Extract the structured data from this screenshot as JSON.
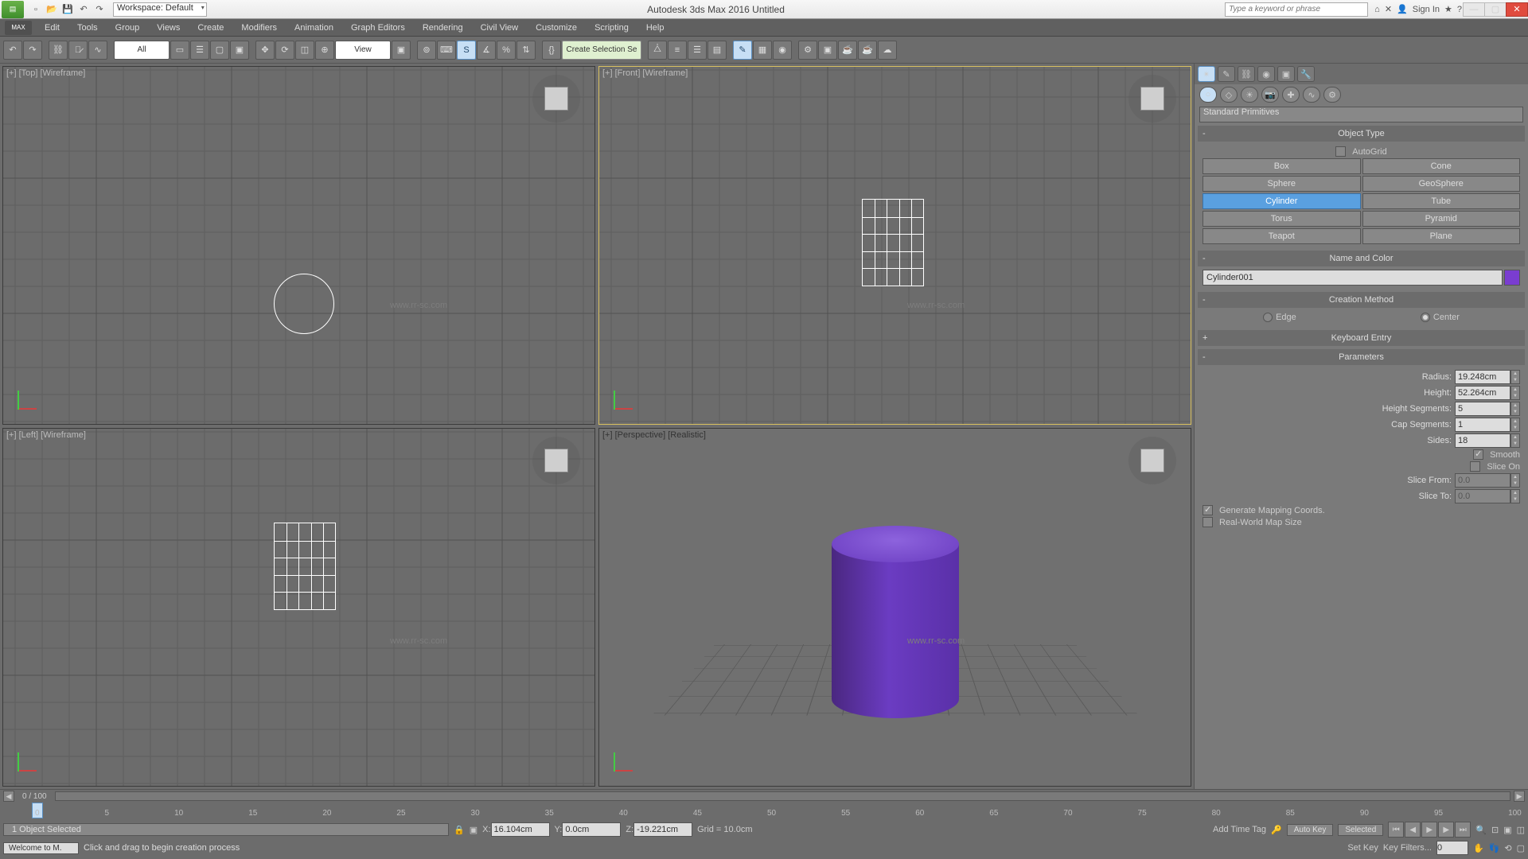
{
  "title": "Autodesk 3ds Max 2016   Untitled",
  "workspace": "Workspace: Default",
  "search_placeholder": "Type a keyword or phrase",
  "sign_in": "Sign In",
  "menus": [
    "Edit",
    "Tools",
    "Group",
    "Views",
    "Create",
    "Modifiers",
    "Animation",
    "Graph Editors",
    "Rendering",
    "Civil View",
    "Customize",
    "Scripting",
    "Help"
  ],
  "toolbar": {
    "filter": "All",
    "named_sel": "Create Selection Se",
    "view": "View"
  },
  "viewports": {
    "top": "[+] [Top] [Wireframe]",
    "front": "[+] [Front] [Wireframe]",
    "left": "[+] [Left] [Wireframe]",
    "persp": "[+] [Perspective] [Realistic]"
  },
  "panel": {
    "category": "Standard Primitives",
    "object_type": "Object Type",
    "autogrid": "AutoGrid",
    "primitives": [
      [
        "Box",
        "Cone"
      ],
      [
        "Sphere",
        "GeoSphere"
      ],
      [
        "Cylinder",
        "Tube"
      ],
      [
        "Torus",
        "Pyramid"
      ],
      [
        "Teapot",
        "Plane"
      ]
    ],
    "active": "Cylinder",
    "name_color": "Name and Color",
    "name": "Cylinder001",
    "creation_method": "Creation Method",
    "edge": "Edge",
    "center": "Center",
    "keyboard_entry": "Keyboard Entry",
    "parameters": "Parameters",
    "params": {
      "radius_label": "Radius:",
      "radius": "19.248cm",
      "height_label": "Height:",
      "height": "52.264cm",
      "height_seg_label": "Height Segments:",
      "height_seg": "5",
      "cap_seg_label": "Cap Segments:",
      "cap_seg": "1",
      "sides_label": "Sides:",
      "sides": "18",
      "smooth": "Smooth",
      "slice_on": "Slice On",
      "slice_from_label": "Slice From:",
      "slice_from": "0.0",
      "slice_to_label": "Slice To:",
      "slice_to": "0.0",
      "gen_mapping": "Generate Mapping Coords.",
      "real_world": "Real-World Map Size"
    }
  },
  "timeline": {
    "pos": "0 / 100",
    "ticks": [
      "0",
      "5",
      "10",
      "15",
      "20",
      "25",
      "30",
      "35",
      "40",
      "45",
      "50",
      "55",
      "60",
      "65",
      "70",
      "75",
      "80",
      "85",
      "90",
      "95",
      "100"
    ]
  },
  "status": {
    "selected": "1 Object Selected",
    "x_label": "X:",
    "x": "16.104cm",
    "y_label": "Y:",
    "y": "0.0cm",
    "z_label": "Z:",
    "z": "-19.221cm",
    "grid": "Grid = 10.0cm",
    "add_time_tag": "Add Time Tag",
    "auto_key": "Auto Key",
    "set_key": "Set Key",
    "sel_filter": "Selected",
    "key_filters": "Key Filters..."
  },
  "prompt": {
    "maxscript": "Welcome to M.",
    "msg": "Click and drag to begin creation process"
  },
  "watermark": "www.rr-sc.com"
}
